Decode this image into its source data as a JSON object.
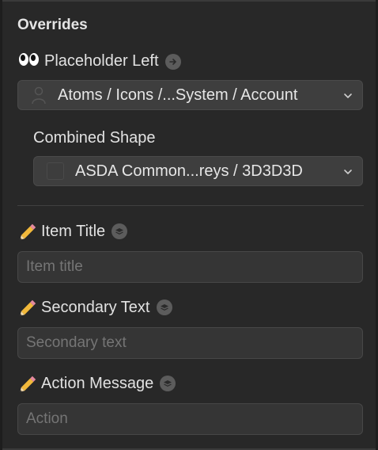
{
  "overrides": {
    "title": "Overrides",
    "placeholder_left": {
      "label": "Placeholder Left",
      "select_value": "Atoms / Icons /...System / Account"
    },
    "combined_shape": {
      "label": "Combined Shape",
      "select_value": "ASDA Common...reys / 3D3D3D",
      "swatch_color": "#3D3D3D"
    }
  },
  "text_overrides": [
    {
      "label": "Item Title",
      "placeholder": "Item title"
    },
    {
      "label": "Secondary Text",
      "placeholder": "Secondary text"
    },
    {
      "label": "Action Message",
      "placeholder": "Action"
    }
  ],
  "icons": {
    "placeholder_left_icon": "eyes-emoji-icon",
    "text_override_icon": "pencil-emoji-icon",
    "go_to_symbol": "arrow-right-circle-icon",
    "text_style": "layers-icon",
    "chevron": "chevron-down-icon"
  }
}
